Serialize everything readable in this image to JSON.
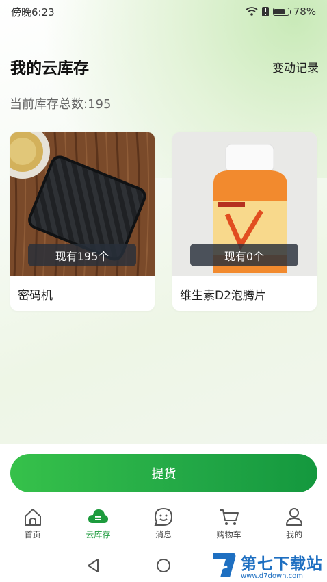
{
  "status": {
    "time": "傍晚6:23",
    "battery": "78%",
    "battery_level": 0.78
  },
  "header": {
    "title": "我的云库存",
    "history_link": "变动记录"
  },
  "summary": {
    "total_label": "当前库存总数:195"
  },
  "items": [
    {
      "name": "密码机",
      "stock": "现有195个"
    },
    {
      "name": "维生素D2泡腾片",
      "stock": "现有0个"
    }
  ],
  "actions": {
    "pickup": "提货"
  },
  "tabs": [
    {
      "label": "首页",
      "icon": "home-icon",
      "active": false
    },
    {
      "label": "云库存",
      "icon": "cloud-icon",
      "active": true
    },
    {
      "label": "消息",
      "icon": "message-icon",
      "active": false
    },
    {
      "label": "购物车",
      "icon": "cart-icon",
      "active": false
    },
    {
      "label": "我的",
      "icon": "user-icon",
      "active": false
    }
  ],
  "watermark": {
    "title": "第七下载站",
    "url": "www.d7down.com"
  },
  "colors": {
    "accent": "#1d9b3d",
    "button_start": "#36c14a",
    "button_end": "#14983e",
    "watermark": "#1e6fc1"
  }
}
